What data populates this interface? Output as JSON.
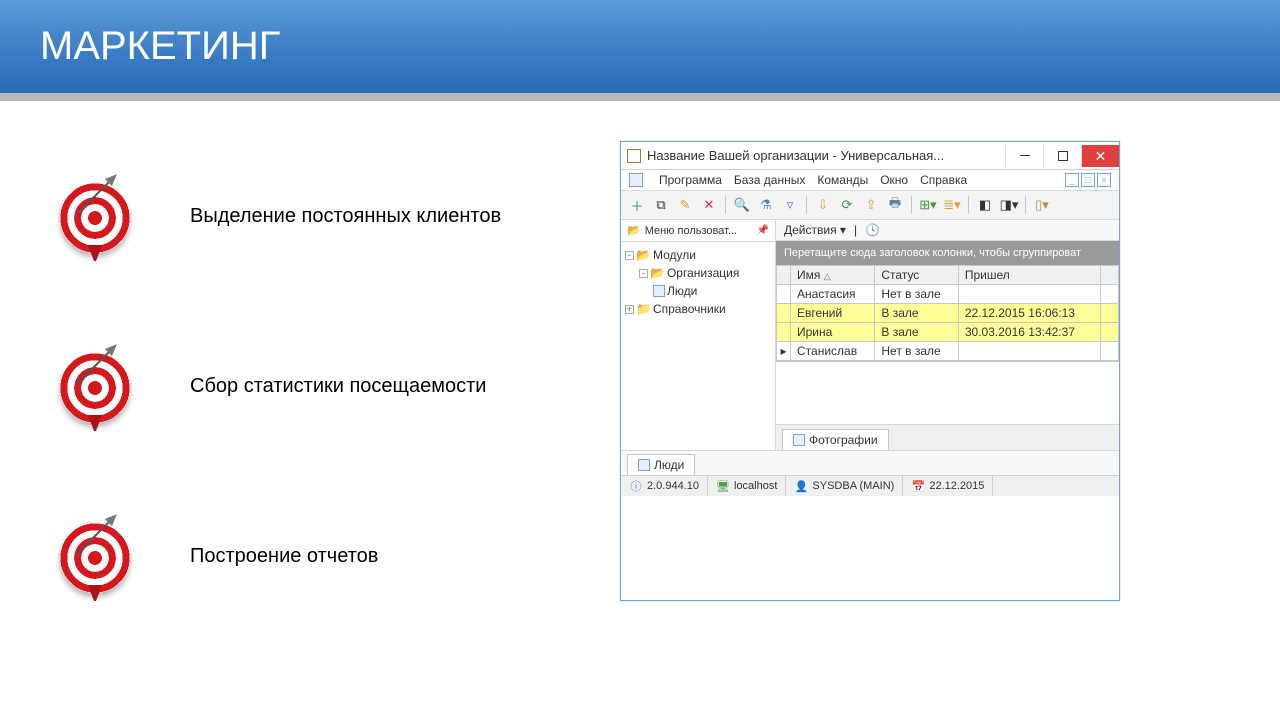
{
  "slide": {
    "title": "МАРКЕТИНГ",
    "bullets": [
      "Выделение постоянных клиентов",
      "Сбор статистики посещаемости",
      "Построение отчетов"
    ]
  },
  "app": {
    "window_title": "Название Вашей организации - Универсальная...",
    "menu": [
      "Программа",
      "База данных",
      "Команды",
      "Окно",
      "Справка"
    ],
    "sidebar": {
      "header": "Меню пользоват...",
      "tree": {
        "root": "Модули",
        "org": "Организация",
        "people": "Люди",
        "refs": "Справочники"
      }
    },
    "actions_label": "Действия",
    "group_hint": "Перетащите сюда заголовок колонки, чтобы сгруппироват",
    "columns": [
      "Имя",
      "Статус",
      "Пришел"
    ],
    "rows": [
      {
        "name": "Анастасия",
        "status": "Нет в зале",
        "arrived": "",
        "hl": false,
        "mark": ""
      },
      {
        "name": "Евгений",
        "status": "В зале",
        "arrived": "22.12.2015 16:06:13",
        "hl": true,
        "mark": ""
      },
      {
        "name": "Ирина",
        "status": "В зале",
        "arrived": "30.03.2016 13:42:37",
        "hl": true,
        "mark": ""
      },
      {
        "name": "Станислав",
        "status": "Нет в зале",
        "arrived": "",
        "hl": false,
        "mark": "▸"
      }
    ],
    "photos_tab": "Фотографии",
    "bottom_tab": "Люди",
    "status": {
      "version": "2.0.944.10",
      "host": "localhost",
      "user": "SYSDBA (MAIN)",
      "date": "22.12.2015"
    }
  }
}
